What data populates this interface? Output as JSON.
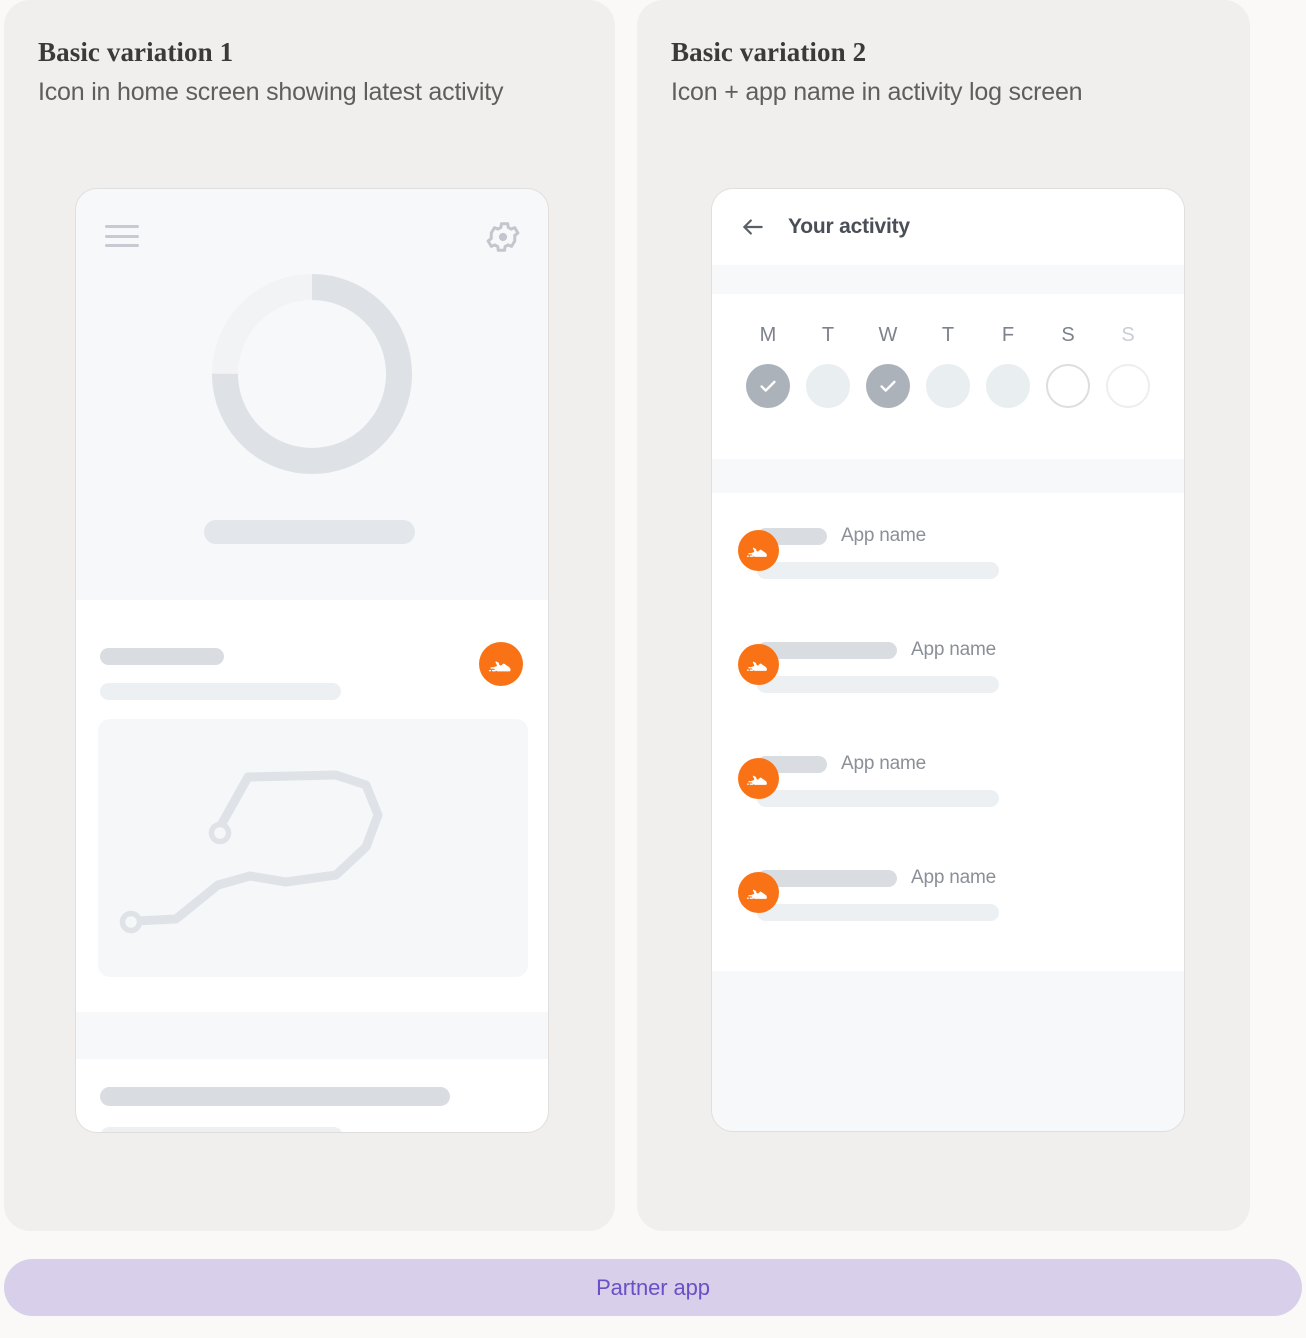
{
  "page": {
    "background": "#FAF9F8",
    "panel_background": "#F0EFED",
    "accent_orange": "#F97316",
    "partner_bar_bg": "#D8CFEA",
    "partner_text_color": "#6A4FC6"
  },
  "panels": [
    {
      "title": "Basic variation 1",
      "subtitle": "Icon in home screen showing latest activity",
      "icons": {
        "menu": "hamburger-menu-icon",
        "settings": "gear-icon",
        "app": "running-shoe-icon"
      }
    },
    {
      "title": "Basic variation 2",
      "subtitle": "Icon + app name in activity log screen",
      "icons": {
        "back": "back-arrow-icon",
        "app": "running-shoe-icon"
      }
    }
  ],
  "activity_screen": {
    "header_title": "Your activity",
    "days": [
      {
        "label": "M",
        "state": "done",
        "faded": false
      },
      {
        "label": "T",
        "state": "pending",
        "faded": false
      },
      {
        "label": "W",
        "state": "done",
        "faded": false
      },
      {
        "label": "T",
        "state": "pending",
        "faded": false
      },
      {
        "label": "F",
        "state": "pending",
        "faded": false
      },
      {
        "label": "S",
        "state": "future",
        "faded": false
      },
      {
        "label": "S",
        "state": "future-faded",
        "faded": true
      }
    ],
    "rows": [
      {
        "app_name": "App name",
        "pill_width": 70,
        "name_first": false
      },
      {
        "app_name": "App name",
        "pill_width": 140,
        "name_first": false
      },
      {
        "app_name": "App name",
        "pill_width": 70,
        "name_first": false
      },
      {
        "app_name": "App name",
        "pill_width": 140,
        "name_first": false
      }
    ]
  },
  "footer": {
    "partner_label": "Partner app"
  }
}
